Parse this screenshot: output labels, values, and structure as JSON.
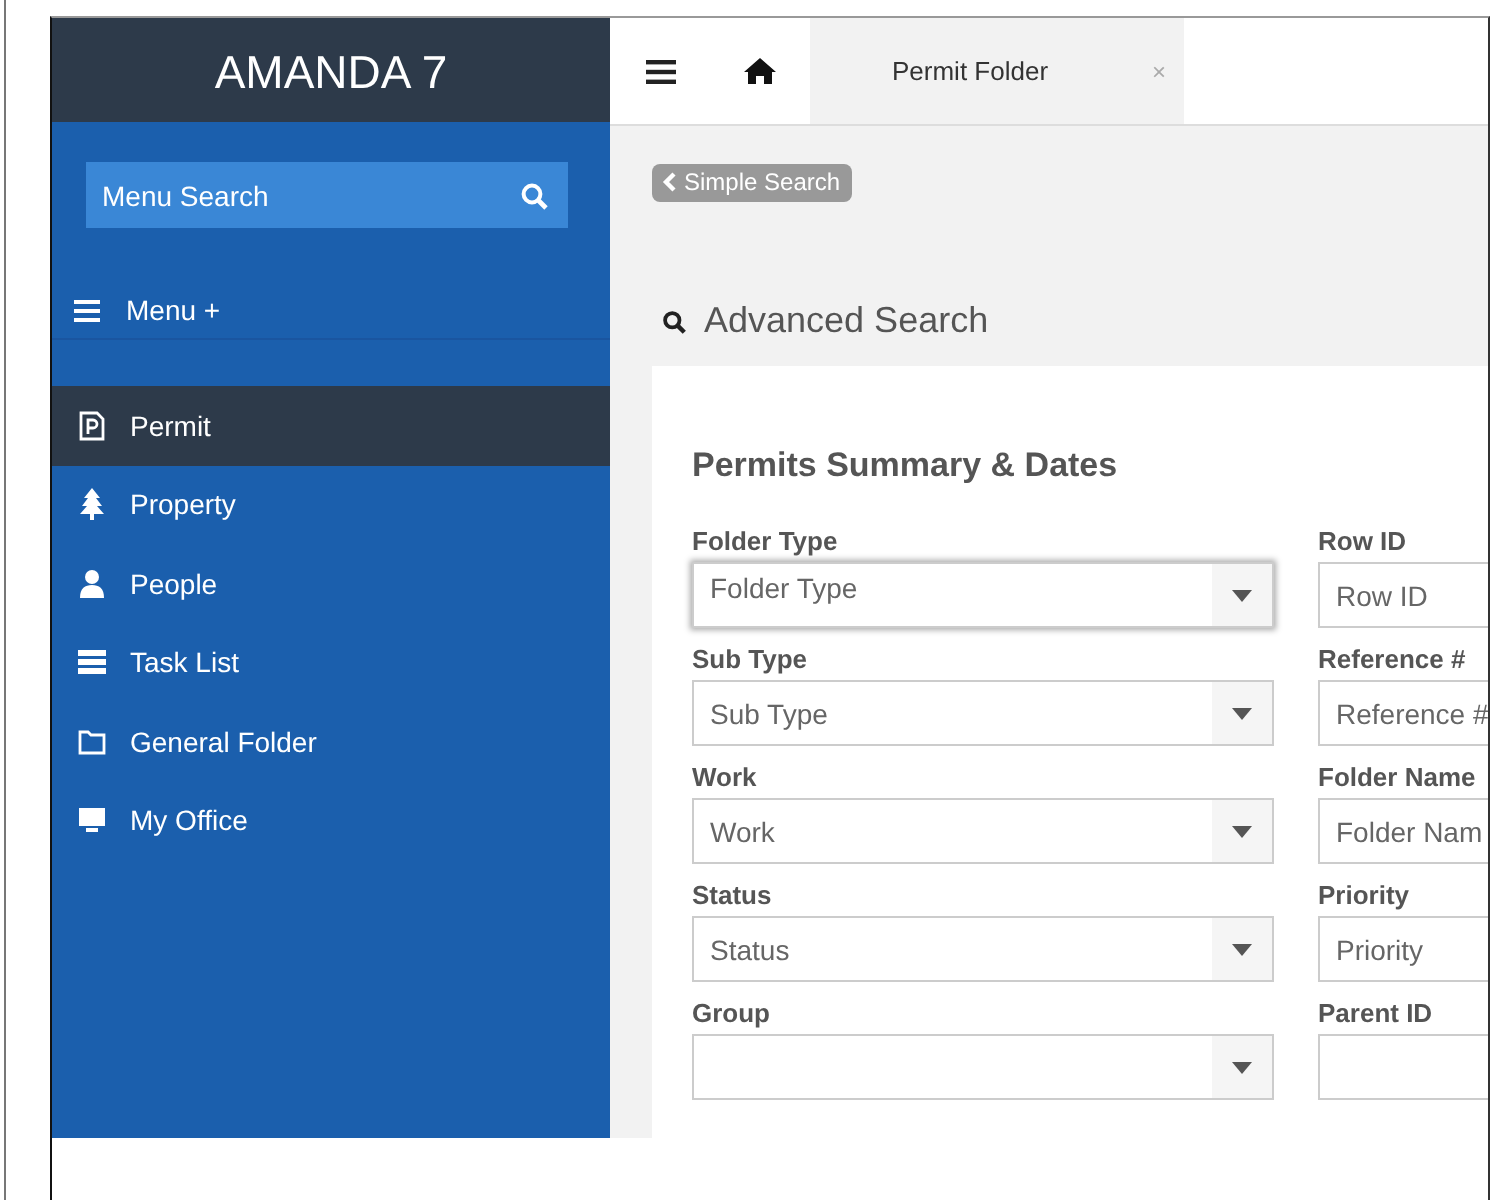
{
  "sidebar": {
    "logo": "AMANDA 7",
    "search": {
      "placeholder": "Menu Search"
    },
    "menu_label": "Menu +",
    "items": [
      {
        "label": "Permit",
        "selected": true
      },
      {
        "label": "Property",
        "selected": false
      },
      {
        "label": "People",
        "selected": false
      },
      {
        "label": "Task List",
        "selected": false
      },
      {
        "label": "General Folder",
        "selected": false
      },
      {
        "label": "My Office",
        "selected": false
      }
    ]
  },
  "topbar": {
    "tabs": [
      {
        "label": "Permit Folder",
        "close": "×",
        "selected": true
      }
    ]
  },
  "back_button": "Simple Search",
  "heading": "Advanced Search",
  "section_title": "Permits Summary & Dates",
  "rows": [
    [
      {
        "label": "Folder Type",
        "placeholder": "Folder Type",
        "kind": "select",
        "focused": true
      },
      {
        "label": "Row ID",
        "placeholder": "Row ID",
        "kind": "text",
        "focused": false
      }
    ],
    [
      {
        "label": "Sub Type",
        "placeholder": "Sub Type",
        "kind": "select",
        "focused": false
      },
      {
        "label": "Reference #",
        "placeholder": "Reference #",
        "kind": "text",
        "focused": false
      }
    ],
    [
      {
        "label": "Work",
        "placeholder": "Work",
        "kind": "select",
        "focused": false
      },
      {
        "label": "Folder Name",
        "placeholder": "Folder Nam",
        "kind": "text",
        "focused": false
      }
    ],
    [
      {
        "label": "Status",
        "placeholder": "Status",
        "kind": "select",
        "focused": false
      },
      {
        "label": "Priority",
        "placeholder": "Priority",
        "kind": "text",
        "focused": false
      }
    ],
    [
      {
        "label": "Group",
        "kind": "select",
        "focused": false
      },
      {
        "label": "Parent ID",
        "kind": "text",
        "focused": false
      }
    ]
  ]
}
